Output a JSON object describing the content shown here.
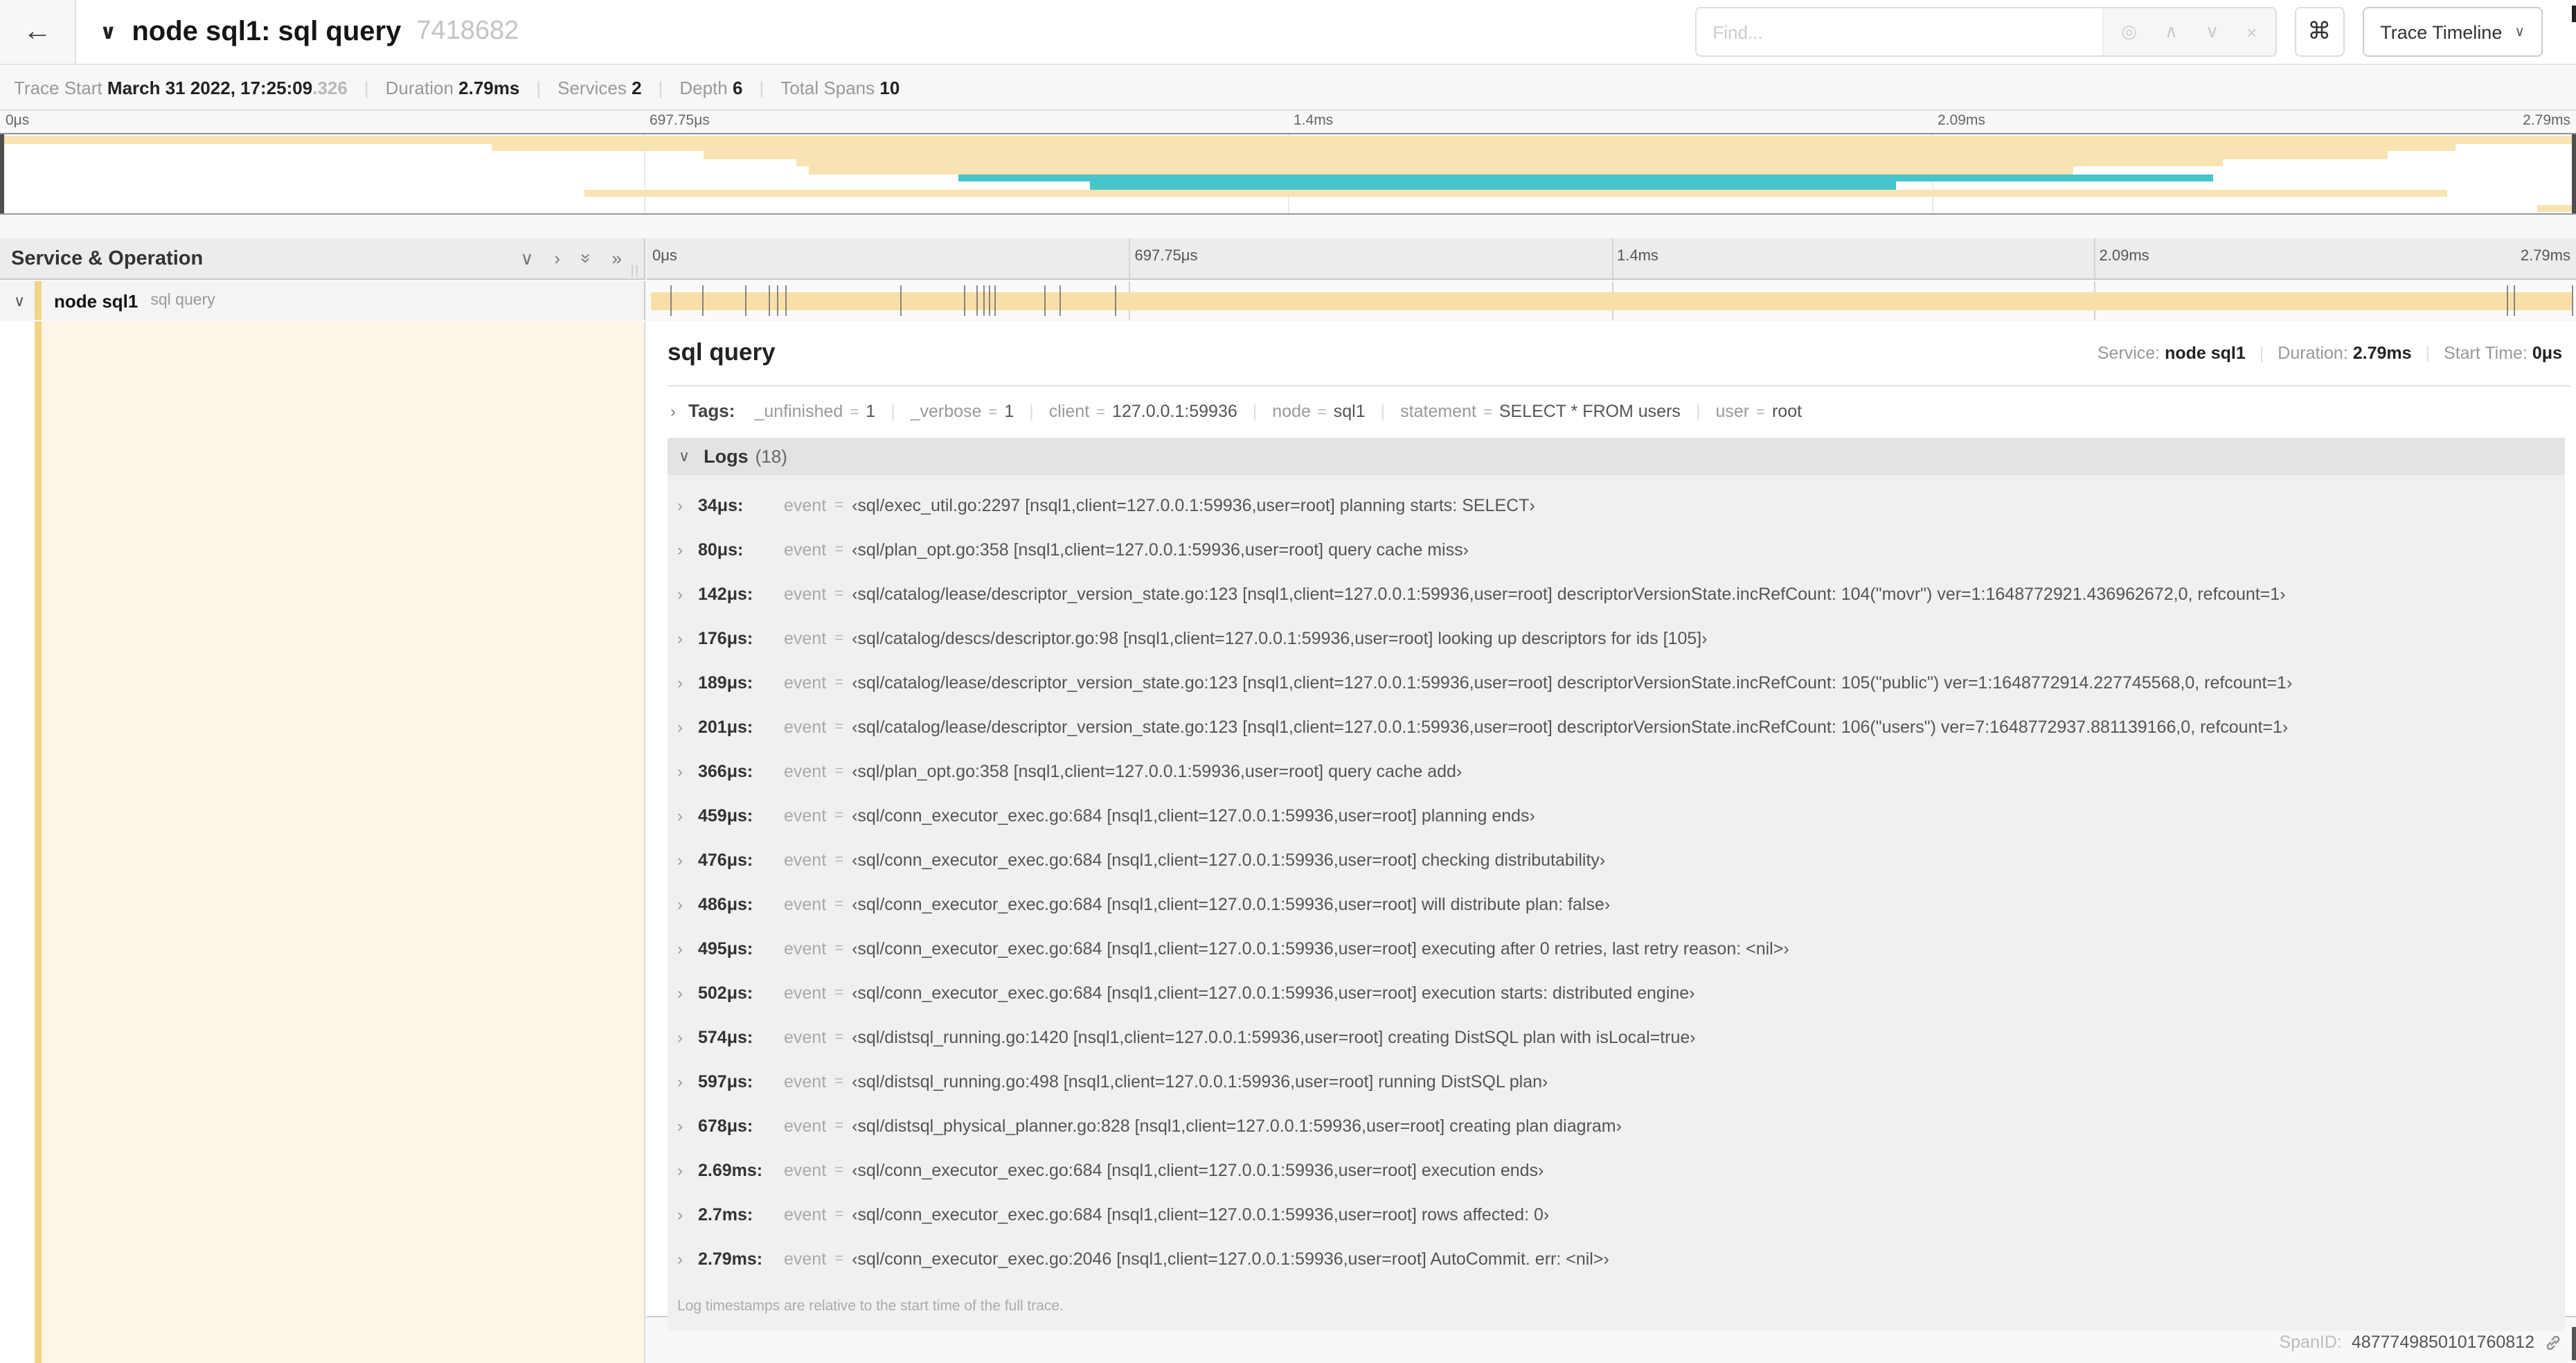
{
  "theme": {
    "span_tan": "#F8DFA8",
    "stripe_tan": "#F2D38A",
    "cream": "#FDF6E7"
  },
  "header": {
    "back_icon": "←",
    "collapse_chevron": "∨",
    "title": "node sql1: sql query",
    "trace_id": "7418682",
    "find_placeholder": "Find...",
    "find_icons": {
      "locate": "◎",
      "prev": "∧",
      "next": "∨",
      "clear": "×"
    },
    "shortcut_icon": "⌘",
    "view_button": {
      "label": "Trace Timeline",
      "chevron": "∨"
    }
  },
  "summary": {
    "items": [
      {
        "label": "Trace Start",
        "value": "March 31 2022, 17:25:09",
        "suffix": ".326"
      },
      {
        "label": "Duration",
        "value": "2.79ms",
        "suffix": ""
      },
      {
        "label": "Services",
        "value": "2",
        "suffix": ""
      },
      {
        "label": "Depth",
        "value": "6",
        "suffix": ""
      },
      {
        "label": "Total Spans",
        "value": "10",
        "suffix": ""
      }
    ]
  },
  "minimap": {
    "colors": {
      "tan": "#F8E3B3",
      "teal": "#45C5C9"
    },
    "ticks": [
      {
        "label": "0μs",
        "pos": 0
      },
      {
        "label": "697.75μs",
        "pos": 0.25
      },
      {
        "label": "1.4ms",
        "pos": 0.5
      },
      {
        "label": "2.09ms",
        "pos": 0.75
      },
      {
        "label": "2.79ms",
        "pos": 1
      }
    ],
    "gridlines": [
      0.25,
      0.5,
      0.75
    ],
    "rows": [
      {
        "s": 0,
        "e": 1,
        "c": "tan"
      },
      {
        "s": 0.191,
        "e": 0.953,
        "c": "tan"
      },
      {
        "s": 0.273,
        "e": 0.927,
        "c": "tan"
      },
      {
        "s": 0.309,
        "e": 0.863,
        "c": "tan"
      },
      {
        "s": 0.314,
        "e": 0.805,
        "c": "tan"
      },
      {
        "s": 0.372,
        "e": 0.859,
        "c": "teal"
      },
      {
        "s": 0.423,
        "e": 0.736,
        "c": "teal"
      },
      {
        "s": 0.227,
        "e": 0.95,
        "c": "tan"
      },
      {
        "s": 0,
        "e": 0,
        "c": "tan"
      },
      {
        "s": 0.985,
        "e": 1,
        "c": "tan"
      }
    ]
  },
  "timeline": {
    "left_header": "Service & Operation",
    "header_icons": {
      "chevron_down": "∨",
      "chevron_right": "›",
      "double_chevron": "»"
    },
    "resizer_grip": "||",
    "ticks": [
      {
        "label": "0μs",
        "pos": 0
      },
      {
        "label": "697.75μs",
        "pos": 0.25
      },
      {
        "label": "1.4ms",
        "pos": 0.5
      },
      {
        "label": "2.09ms",
        "pos": 0.75
      },
      {
        "label": "2.79ms",
        "pos": 1
      }
    ],
    "gridlines": [
      0.25,
      0.5,
      0.75
    ],
    "row": {
      "chevron": "∨",
      "service": "node sql1",
      "operation": "sql query"
    },
    "log_markers": [
      0.0122,
      0.0287,
      0.0509,
      0.0631,
      0.0677,
      0.072,
      0.1312,
      0.1645,
      0.1706,
      0.1742,
      0.1774,
      0.1799,
      0.2057,
      0.214,
      0.243,
      0.9642,
      0.9677,
      0.998
    ]
  },
  "detail": {
    "title": "sql query",
    "overview": [
      {
        "label": "Service:",
        "value": "node sql1"
      },
      {
        "label": "Duration:",
        "value": "2.79ms"
      },
      {
        "label": "Start Time:",
        "value": "0μs"
      }
    ],
    "tags_chevron": "›",
    "tags_label": "Tags:",
    "tags": [
      {
        "key": "_unfinished",
        "value": "1"
      },
      {
        "key": "_verbose",
        "value": "1"
      },
      {
        "key": "client",
        "value": "127.0.0.1:59936"
      },
      {
        "key": "node",
        "value": "sql1"
      },
      {
        "key": "statement",
        "value": "SELECT * FROM users"
      },
      {
        "key": "user",
        "value": "root"
      }
    ],
    "logs_chevron": "∨",
    "logs_label": "Logs",
    "logs_count": "(18)",
    "log_chevron": "›",
    "log_field": "event",
    "log_eq": "=",
    "logs": [
      {
        "time": "34μs:",
        "value": "‹sql/exec_util.go:2297 [nsql1,client=127.0.0.1:59936,user=root] planning starts: SELECT›"
      },
      {
        "time": "80μs:",
        "value": "‹sql/plan_opt.go:358 [nsql1,client=127.0.0.1:59936,user=root] query cache miss›"
      },
      {
        "time": "142μs:",
        "value": "‹sql/catalog/lease/descriptor_version_state.go:123 [nsql1,client=127.0.0.1:59936,user=root] descriptorVersionState.incRefCount: 104(\"movr\") ver=1:1648772921.436962672,0, refcount=1›"
      },
      {
        "time": "176μs:",
        "value": "‹sql/catalog/descs/descriptor.go:98 [nsql1,client=127.0.0.1:59936,user=root] looking up descriptors for ids [105]›"
      },
      {
        "time": "189μs:",
        "value": "‹sql/catalog/lease/descriptor_version_state.go:123 [nsql1,client=127.0.0.1:59936,user=root] descriptorVersionState.incRefCount: 105(\"public\") ver=1:1648772914.227745568,0, refcount=1›"
      },
      {
        "time": "201μs:",
        "value": "‹sql/catalog/lease/descriptor_version_state.go:123 [nsql1,client=127.0.0.1:59936,user=root] descriptorVersionState.incRefCount: 106(\"users\") ver=7:1648772937.881139166,0, refcount=1›"
      },
      {
        "time": "366μs:",
        "value": "‹sql/plan_opt.go:358 [nsql1,client=127.0.0.1:59936,user=root] query cache add›"
      },
      {
        "time": "459μs:",
        "value": "‹sql/conn_executor_exec.go:684 [nsql1,client=127.0.0.1:59936,user=root] planning ends›"
      },
      {
        "time": "476μs:",
        "value": "‹sql/conn_executor_exec.go:684 [nsql1,client=127.0.0.1:59936,user=root] checking distributability›"
      },
      {
        "time": "486μs:",
        "value": "‹sql/conn_executor_exec.go:684 [nsql1,client=127.0.0.1:59936,user=root] will distribute plan: false›"
      },
      {
        "time": "495μs:",
        "value": "‹sql/conn_executor_exec.go:684 [nsql1,client=127.0.0.1:59936,user=root] executing after 0 retries, last retry reason: <nil>›"
      },
      {
        "time": "502μs:",
        "value": "‹sql/conn_executor_exec.go:684 [nsql1,client=127.0.0.1:59936,user=root] execution starts: distributed engine›"
      },
      {
        "time": "574μs:",
        "value": "‹sql/distsql_running.go:1420 [nsql1,client=127.0.0.1:59936,user=root] creating DistSQL plan with isLocal=true›"
      },
      {
        "time": "597μs:",
        "value": "‹sql/distsql_running.go:498 [nsql1,client=127.0.0.1:59936,user=root] running DistSQL plan›"
      },
      {
        "time": "678μs:",
        "value": "‹sql/distsql_physical_planner.go:828 [nsql1,client=127.0.0.1:59936,user=root] creating plan diagram›"
      },
      {
        "time": "2.69ms:",
        "value": "‹sql/conn_executor_exec.go:684 [nsql1,client=127.0.0.1:59936,user=root] execution ends›"
      },
      {
        "time": "2.7ms:",
        "value": "‹sql/conn_executor_exec.go:684 [nsql1,client=127.0.0.1:59936,user=root] rows affected: 0›"
      },
      {
        "time": "2.79ms:",
        "value": "‹sql/conn_executor_exec.go:2046 [nsql1,client=127.0.0.1:59936,user=root] AutoCommit. err: <nil>›"
      }
    ],
    "footer_note": "Log timestamps are relative to the start time of the full trace.",
    "spanid_label": "SpanID:",
    "spanid": "4877749850101760812"
  }
}
